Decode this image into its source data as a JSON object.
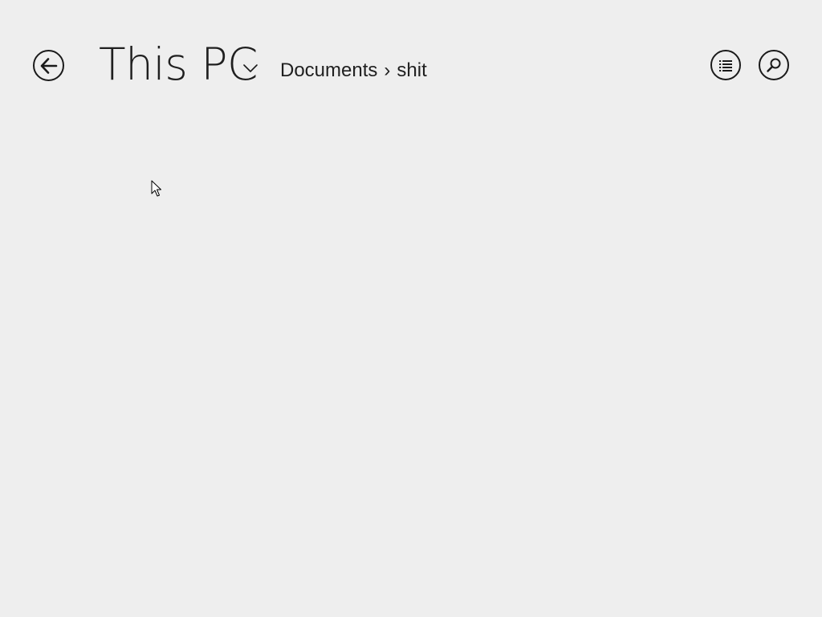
{
  "app": {
    "title": "This PC",
    "background": "#eeeeee",
    "foreground": "#1f1f1f"
  },
  "header": {
    "back_button": {
      "icon": "back-arrow-icon"
    },
    "location": {
      "title": "This PC",
      "dropdown_icon": "chevron-down-icon"
    },
    "breadcrumb": [
      {
        "label": "Documents"
      },
      {
        "label": "shit"
      }
    ],
    "breadcrumb_separator": "›",
    "view_button": {
      "icon": "list-view-icon"
    },
    "search_button": {
      "icon": "search-icon"
    }
  },
  "content": {
    "items": []
  }
}
